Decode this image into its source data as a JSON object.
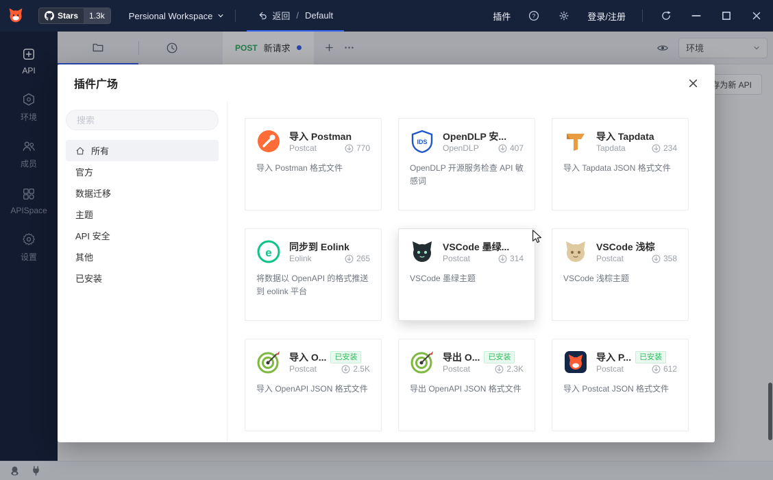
{
  "topbar": {
    "stars_label": "Stars",
    "stars_count": "1.3k",
    "workspace": "Persional Workspace",
    "back": "返回",
    "breadcrumb_sep": "/",
    "project": "Default",
    "plugin_button": "插件",
    "login": "登录/注册"
  },
  "sidebar": {
    "items": [
      {
        "label": "API",
        "icon": "api-icon",
        "active": true
      },
      {
        "label": "环境",
        "icon": "environment-icon"
      },
      {
        "label": "成员",
        "icon": "members-icon"
      },
      {
        "label": "APISpace",
        "icon": "apispace-icon"
      },
      {
        "label": "设置",
        "icon": "settings-icon"
      }
    ]
  },
  "tabstrip": {
    "method": "POST",
    "tab_title": "新请求",
    "env_label": "环境"
  },
  "content": {
    "save_button": "存为新 API"
  },
  "modal": {
    "title": "插件广场",
    "search_placeholder": "搜索",
    "installed_badge": "已安装",
    "categories": [
      {
        "label": "所有",
        "icon": "home-icon",
        "selected": true
      },
      {
        "label": "官方"
      },
      {
        "label": "数据迁移"
      },
      {
        "label": "主题"
      },
      {
        "label": "API 安全"
      },
      {
        "label": "其他"
      },
      {
        "label": "已安装"
      }
    ],
    "plugins": [
      {
        "name": "导入 Postman",
        "author": "Postcat",
        "downloads": "770",
        "desc": "导入 Postman 格式文件",
        "icon": "postman-icon"
      },
      {
        "name": "OpenDLP 安...",
        "author": "OpenDLP",
        "downloads": "407",
        "desc": "OpenDLP 开源服务检查 API 敏感词",
        "icon": "opendlp-shield-icon"
      },
      {
        "name": "导入 Tapdata",
        "author": "Tapdata",
        "downloads": "234",
        "desc": "导入 Tapdata JSON 格式文件",
        "icon": "tapdata-icon"
      },
      {
        "name": "同步到 Eolink",
        "author": "Eolink",
        "downloads": "265",
        "desc": "将数据以 OpenAPI 的格式推送到 eolink 平台",
        "icon": "eolink-icon"
      },
      {
        "name": "VSCode 墨绿...",
        "author": "Postcat",
        "downloads": "314",
        "desc": "VSCode 墨绿主题",
        "icon": "vscode-dark-cat-icon",
        "hovered": true
      },
      {
        "name": "VSCode 浅棕",
        "author": "Postcat",
        "downloads": "358",
        "desc": "VSCode 浅棕主题",
        "icon": "vscode-light-cat-icon"
      },
      {
        "name": "导入 O...",
        "author": "Postcat",
        "downloads": "2.5K",
        "desc": "导入 OpenAPI JSON 格式文件",
        "icon": "openapi-import-icon",
        "installed": true
      },
      {
        "name": "导出 O...",
        "author": "Postcat",
        "downloads": "2.3K",
        "desc": "导出 OpenAPI JSON 格式文件",
        "icon": "openapi-export-icon",
        "installed": true
      },
      {
        "name": "导入 P...",
        "author": "Postcat",
        "downloads": "612",
        "desc": "导入 Postcat JSON 格式文件",
        "icon": "postcat-cat-icon",
        "installed": true
      }
    ]
  }
}
